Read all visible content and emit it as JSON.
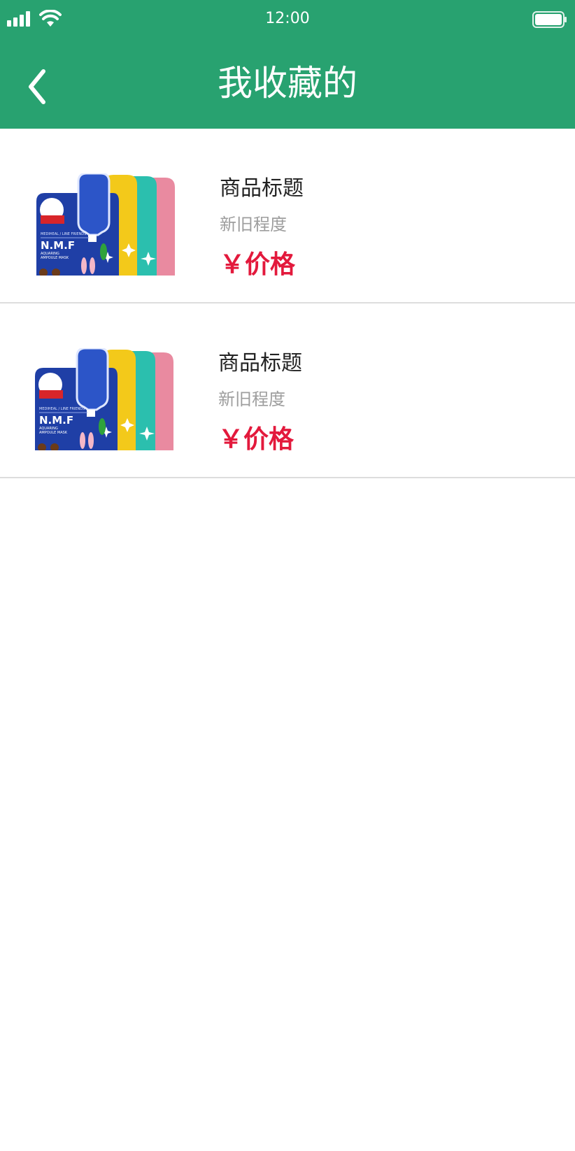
{
  "status_bar": {
    "time": "12:00"
  },
  "nav": {
    "title": "我收藏的",
    "back_icon": "chevron-left-icon"
  },
  "colors": {
    "header": "#28a270",
    "price": "#e3193c",
    "divider": "#dddddd"
  },
  "favorites": [
    {
      "title": "商品标题",
      "condition": "新旧程度",
      "price": "￥价格",
      "image": "product-image-face-masks",
      "image_text": {
        "brand_line": "MEDIHEAL / LINE FRIENDS",
        "name": "N.M.F",
        "sub1": "AQUARING",
        "sub2": "AMPOULE MASK"
      }
    },
    {
      "title": "商品标题",
      "condition": "新旧程度",
      "price": "￥价格",
      "image": "product-image-face-masks",
      "image_text": {
        "brand_line": "MEDIHEAL / LINE FRIENDS",
        "name": "N.M.F",
        "sub1": "AQUARING",
        "sub2": "AMPOULE MASK"
      }
    }
  ]
}
